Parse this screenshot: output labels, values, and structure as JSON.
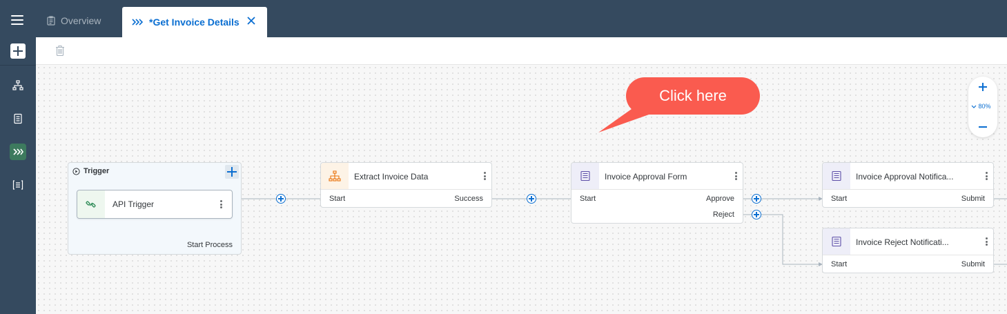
{
  "tabs": [
    {
      "label": "Overview",
      "active": false
    },
    {
      "label": "*Get Invoice Details",
      "active": true
    }
  ],
  "trigger": {
    "header": "Trigger",
    "card_label": "API Trigger",
    "footer": "Start Process"
  },
  "nodes": [
    {
      "title": "Extract Invoice Data",
      "ports_left": [
        "Start"
      ],
      "ports_right": [
        "Success"
      ],
      "icon": "decision-tree-icon"
    },
    {
      "title": "Invoice Approval Form",
      "ports_left": [
        "Start"
      ],
      "ports_right": [
        "Approve",
        "Reject"
      ],
      "icon": "form-icon"
    },
    {
      "title": "Invoice Approval Notifica...",
      "ports_left": [
        "Start"
      ],
      "ports_right": [
        "Submit"
      ],
      "icon": "form-icon"
    },
    {
      "title": "Invoice Reject Notificati...",
      "ports_left": [
        "Start"
      ],
      "ports_right": [
        "Submit"
      ],
      "icon": "form-icon"
    }
  ],
  "callout": "Click here",
  "zoom": {
    "level": "80%"
  },
  "colors": {
    "header_bg": "#354a5f",
    "accent": "#0a6ed1",
    "callout": "#fa5b4f",
    "active_rail": "#3d7a5e"
  }
}
